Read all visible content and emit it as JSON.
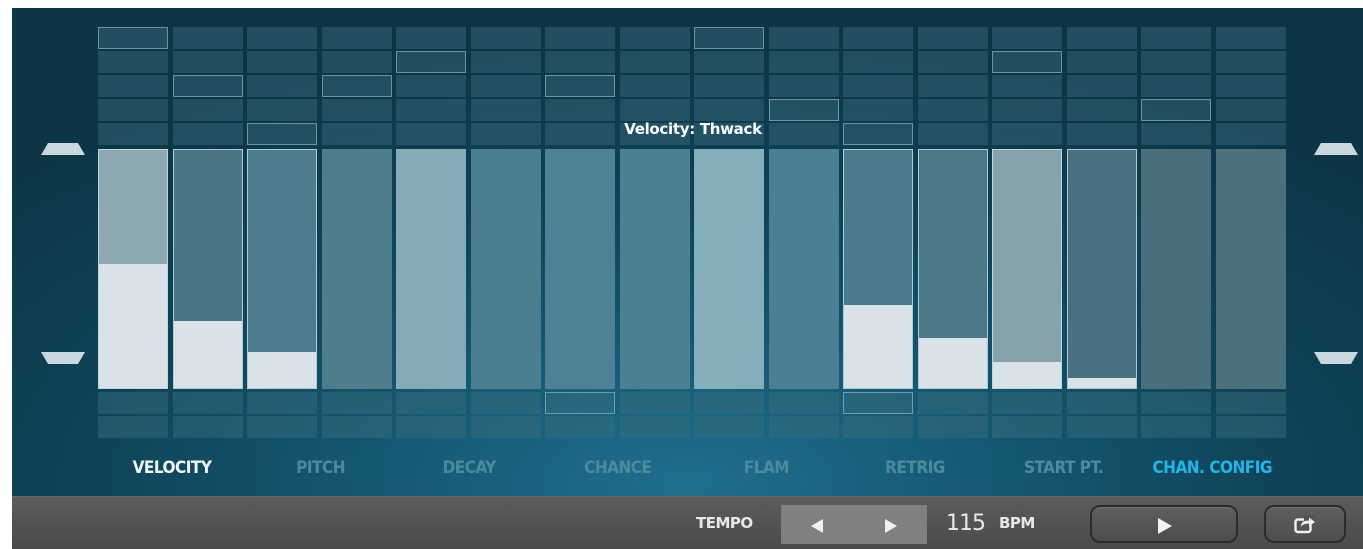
{
  "tooltip": "Velocity: Thwack",
  "tabs": [
    {
      "label": "VELOCITY",
      "state": "active"
    },
    {
      "label": "PITCH",
      "state": "inactive"
    },
    {
      "label": "DECAY",
      "state": "inactive"
    },
    {
      "label": "CHANCE",
      "state": "inactive"
    },
    {
      "label": "FLAM",
      "state": "inactive"
    },
    {
      "label": "RETRIG",
      "state": "inactive"
    },
    {
      "label": "START PT.",
      "state": "inactive"
    },
    {
      "label": "CHAN. CONFIG",
      "state": "highlight"
    }
  ],
  "steps": [
    {
      "highlight_row": 0,
      "selected": true,
      "velocity": 0.52,
      "shade": "#8ea9b2"
    },
    {
      "highlight_row": 2,
      "selected": true,
      "velocity": 0.28,
      "shade": "#4b7785"
    },
    {
      "highlight_row": 4,
      "selected": true,
      "velocity": 0.15,
      "shade": "#4d7d8c"
    },
    {
      "highlight_row": 2,
      "selected": false,
      "velocity": 0,
      "shade": "#4e7d8c"
    },
    {
      "highlight_row": 1,
      "selected": false,
      "velocity": 0,
      "shade": "#85abb6"
    },
    {
      "highlight_row": null,
      "selected": false,
      "velocity": 0,
      "shade": "#4b7f90"
    },
    {
      "highlight_row": 2,
      "selected": false,
      "velocity": 0,
      "shade": "#4d8193"
    },
    {
      "highlight_row": null,
      "selected": false,
      "velocity": 0,
      "shade": "#4b8193"
    },
    {
      "highlight_row": 0,
      "selected": false,
      "velocity": 0,
      "shade": "#85aebb"
    },
    {
      "highlight_row": 3,
      "selected": false,
      "velocity": 0,
      "shade": "#4b8094"
    },
    {
      "highlight_row": 4,
      "selected": true,
      "velocity": 0.35,
      "shade": "#4a7c8d"
    },
    {
      "highlight_row": null,
      "selected": true,
      "velocity": 0.21,
      "shade": "#4a7886"
    },
    {
      "highlight_row": 1,
      "selected": true,
      "velocity": 0.11,
      "shade": "#87a2aa"
    },
    {
      "highlight_row": null,
      "selected": true,
      "velocity": 0.04,
      "shade": "#48707e"
    },
    {
      "highlight_row": 3,
      "selected": false,
      "velocity": 0,
      "shade": "#496f7d"
    },
    {
      "highlight_row": null,
      "selected": false,
      "velocity": 0,
      "shade": "#4b717c"
    }
  ],
  "bottom_highlights": [
    {
      "step": 6,
      "row": 0
    },
    {
      "step": 10,
      "row": 0
    }
  ],
  "transport": {
    "tempo_label": "TEMPO",
    "bpm_value": "115",
    "bpm_label": "BPM"
  },
  "icons": {
    "scroll_up": "triangle-up-icon",
    "scroll_down": "triangle-down-icon",
    "tempo_decrease": "triangle-left-icon",
    "tempo_increase": "triangle-right-icon",
    "play": "play-icon",
    "share": "share-icon"
  }
}
